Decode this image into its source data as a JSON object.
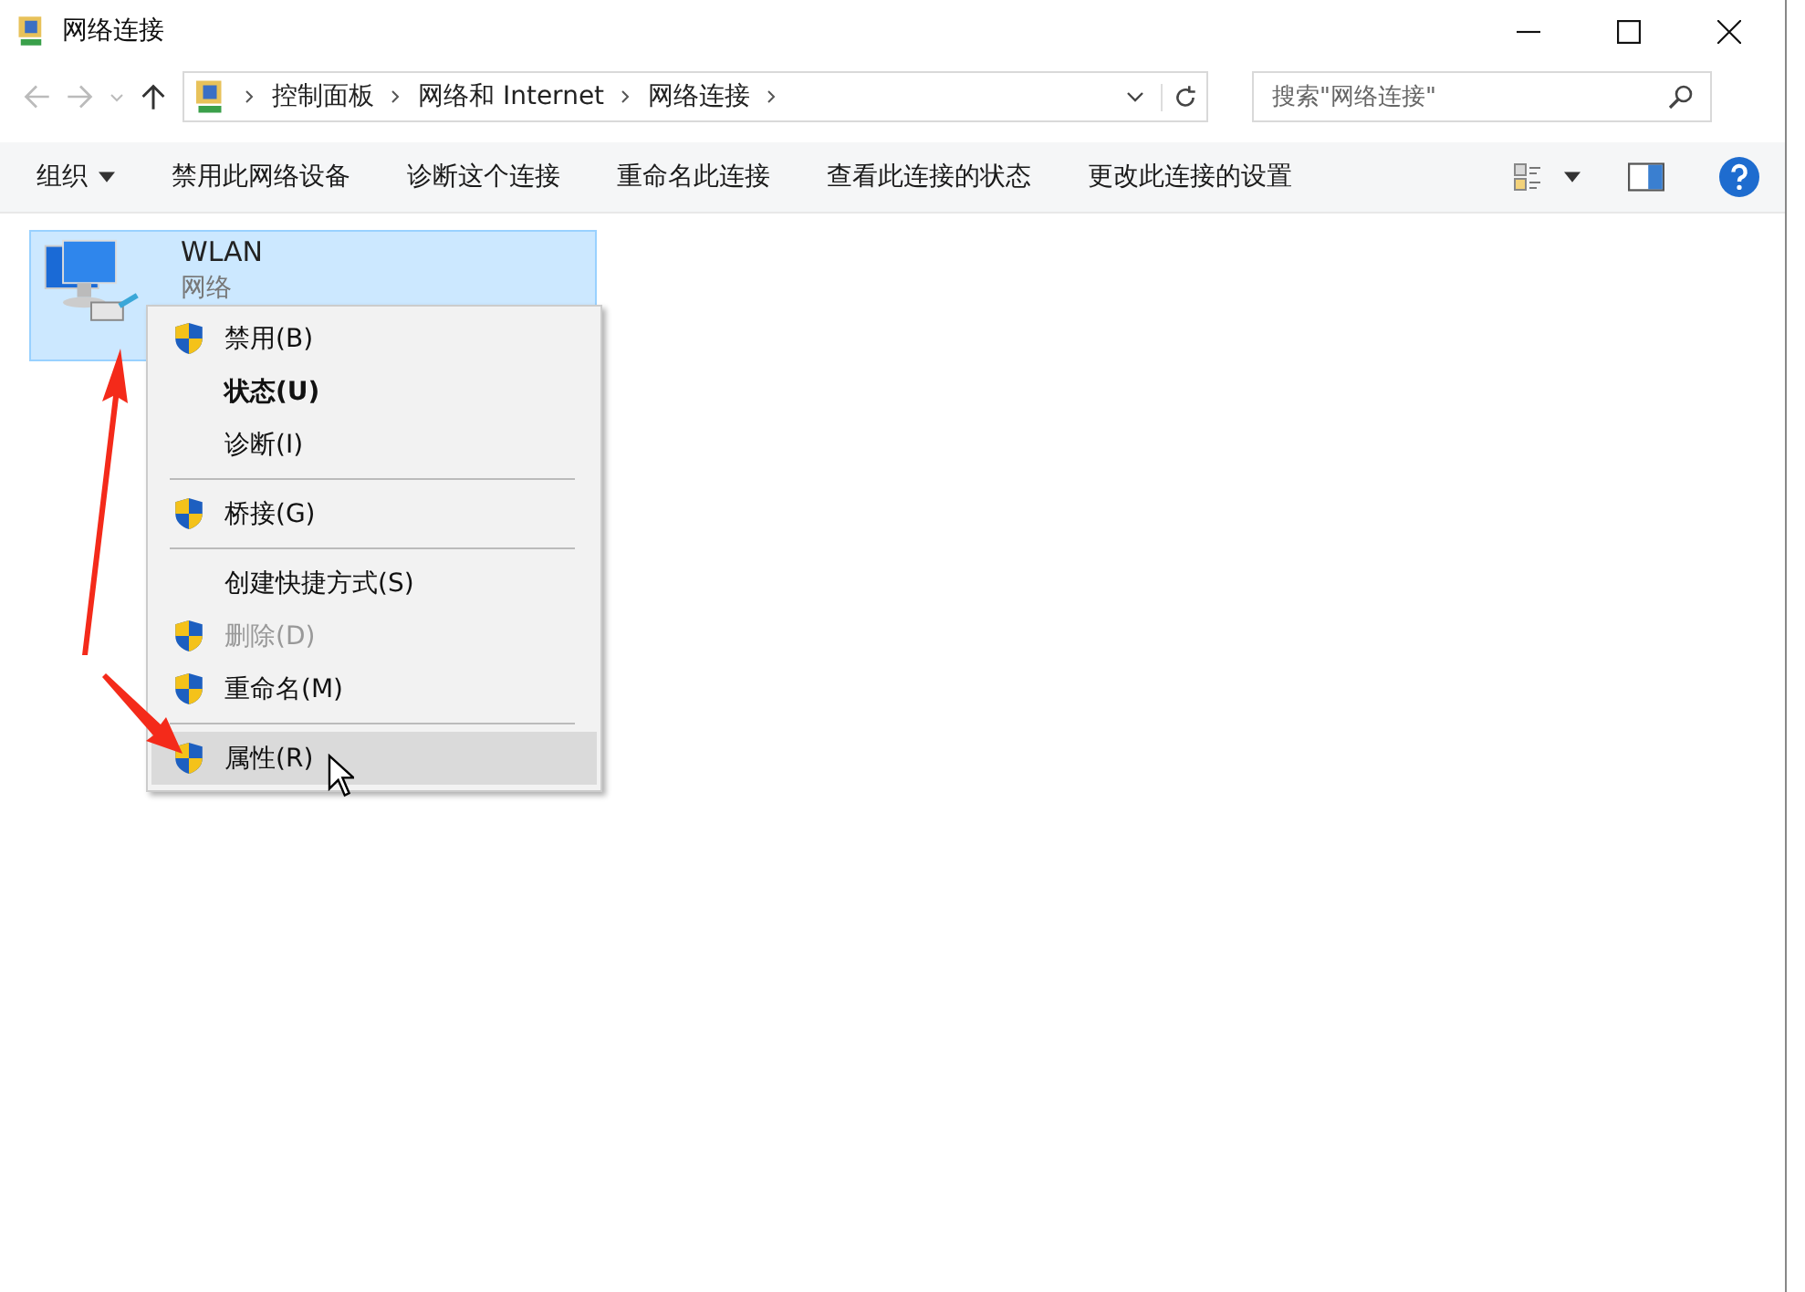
{
  "window": {
    "title": "网络连接"
  },
  "address_bar": {
    "path": [
      "控制面板",
      "网络和 Internet",
      "网络连接"
    ],
    "search": {
      "placeholder": "搜索\"网络连接\""
    }
  },
  "toolbar": {
    "buttons": [
      {
        "label": "组织",
        "dropdown": true
      },
      {
        "label": "禁用此网络设备",
        "dropdown": false
      },
      {
        "label": "诊断这个连接",
        "dropdown": false
      },
      {
        "label": "重命名此连接",
        "dropdown": false
      },
      {
        "label": "查看此连接的状态",
        "dropdown": false
      },
      {
        "label": "更改此连接的设置",
        "dropdown": false
      }
    ]
  },
  "connections": [
    {
      "name": "WLAN",
      "subtitle": "网络",
      "selected": true
    }
  ],
  "context_menu": {
    "items": [
      {
        "kind": "item",
        "label": "禁用(B)",
        "shield": true,
        "bold": false,
        "disabled": false,
        "selected": false
      },
      {
        "kind": "item",
        "label": "状态(U)",
        "shield": false,
        "bold": true,
        "disabled": false,
        "selected": false
      },
      {
        "kind": "item",
        "label": "诊断(I)",
        "shield": false,
        "bold": false,
        "disabled": false,
        "selected": false
      },
      {
        "kind": "separator"
      },
      {
        "kind": "item",
        "label": "桥接(G)",
        "shield": true,
        "bold": false,
        "disabled": false,
        "selected": false
      },
      {
        "kind": "separator"
      },
      {
        "kind": "item",
        "label": "创建快捷方式(S)",
        "shield": false,
        "bold": false,
        "disabled": false,
        "selected": false
      },
      {
        "kind": "item",
        "label": "删除(D)",
        "shield": true,
        "bold": false,
        "disabled": true,
        "selected": false
      },
      {
        "kind": "item",
        "label": "重命名(M)",
        "shield": true,
        "bold": false,
        "disabled": false,
        "selected": false
      },
      {
        "kind": "separator"
      },
      {
        "kind": "item",
        "label": "属性(R)",
        "shield": true,
        "bold": false,
        "disabled": false,
        "selected": true
      }
    ]
  }
}
